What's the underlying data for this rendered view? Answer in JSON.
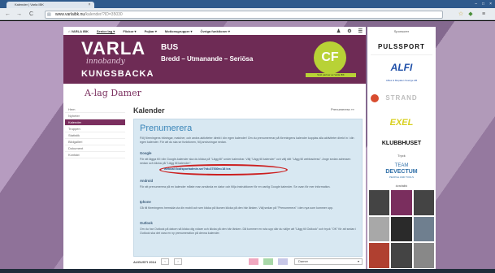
{
  "browser": {
    "tab_title": "Kalender | Varla IBK",
    "tab_close": "×",
    "window_controls": [
      "–",
      "□",
      "×"
    ],
    "nav_back": "←",
    "nav_forward": "→",
    "nav_reload": "C",
    "url_domain": "www.varlaibk.nu",
    "url_path": "/kalender/?ID=35030"
  },
  "site_nav": {
    "home": "⌂ VARLA IBK",
    "items": [
      "Senior lag ▾",
      "Flickor ▾",
      "Pojkar ▾",
      "Motionsgrupper ▾",
      "Övriga funktioner ▾"
    ],
    "icons": [
      "♟",
      "⚙",
      "☰"
    ]
  },
  "banner": {
    "varla": "VARLA",
    "innobandy": "innobandy",
    "kungsbacka": "KUNGSBACKA",
    "bus": "BUS",
    "slogan": "Bredd – Utmanande – Seriösa",
    "cf_logo": "CF",
    "cf_text": "Stolt partner av Varla IBK"
  },
  "team_title": "A-lag Damer",
  "left_nav": [
    "Hem",
    "Nyheter",
    "Kalender",
    "Truppen",
    "Statistik",
    "Bildgalleri",
    "Dokument",
    "Kontakt"
  ],
  "main": {
    "title": "Kalender",
    "subscribe_link": "Prenumerera »»",
    "subscribe_title": "Prenumerera",
    "intro": "Följ föreningens träningar, matcher, och andra aktiviteter direkt i din egen kalender! Om du prenumererar på föreningens kalender kopplas alla aktiviteter direkt in i din egen kalender. För att du ska se funktionen, följ anvisningar nedan.",
    "google_head": "Google",
    "google_text": "För att lägga till i din Google-kalender ska du klicka på \"Lägg till\" under kalendrar. Välj \"Lägg till kalender\" och välj rätt \"Lägg till webbadress\". Ange sedan adressen nedan och klicka på \"Lägg till kalender\".",
    "ical_link": "webcal://calsportadmin.se/?id=37530e=18 ics",
    "android_head": "Android",
    "android_text": "För att prenumerera på en kalender måste man använda en dator och följa instruktioner för en vanlig Google kalender. Se ovan för mer information.",
    "iphone_head": "Iphone",
    "iphone_text": "Gå till föreningens hemsida via din mobil och sen klicka på ikonen klicka på den här länken. Välj sedan på \"Prenumerera\" i den nya som kommer upp.",
    "outlook_head": "Outlook",
    "outlook_text": "Om du har Outlook på datorn så klicka dig vidare och klicka på den här länken. Då kommer en ruta upp där du väljer att \"Lägg till Outlook\" och tryck \"OK\" för att sedan i Outlook ska det vara en ny prenumeration på denna kalender."
  },
  "calendar": {
    "month": "AUGUSTI 2014",
    "prev": "‹",
    "next": "›",
    "swatch_colors": [
      "#f0a8c0",
      "#a8d8a8",
      "#c8c8e8"
    ],
    "filter_selected": "Damer"
  },
  "sponsors": {
    "heading": "Sponsorer",
    "pulssport": "PULSSPORT",
    "alfi": "ALFI",
    "alfi_sub": "Alfies & Mopalen Sverige AB",
    "strand": "STRAND",
    "exel": "EXEL",
    "klubbhuset": "KLUBBHUSET",
    "tryck": "Tryck",
    "team_label": "TEAM",
    "devectum": "DEVECTUM",
    "team_sub": "PEOPLE AND TOOLS",
    "varla_tag": "#varlaibk"
  }
}
